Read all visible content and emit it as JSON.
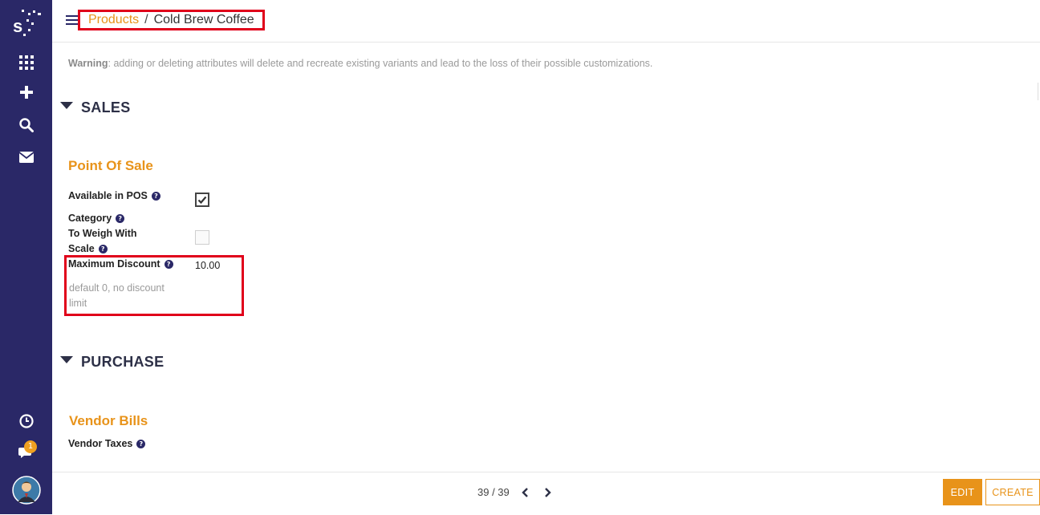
{
  "breadcrumb": {
    "parent": "Products",
    "separator": "/",
    "current": "Cold Brew Coffee"
  },
  "warning": {
    "label": "Warning",
    "text": ": adding or deleting attributes will delete and recreate existing variants and lead to the loss of their possible customizations."
  },
  "sections": {
    "sales": {
      "title": "SALES",
      "group": "Point Of Sale",
      "fields": {
        "available_in_pos": {
          "label": "Available in POS",
          "checked": true
        },
        "category": {
          "label": "Category",
          "value": ""
        },
        "to_weigh": {
          "label_line1": "To Weigh With",
          "label_line2": "Scale",
          "checked": false
        },
        "max_discount": {
          "label": "Maximum Discount",
          "value": "10.00",
          "hint": "default 0, no discount limit"
        }
      }
    },
    "purchase": {
      "title": "PURCHASE",
      "group": "Vendor Bills",
      "fields": {
        "vendor_taxes": {
          "label": "Vendor Taxes"
        }
      }
    }
  },
  "sidebar": {
    "icons": [
      "logo-icon",
      "apps-icon",
      "plus-icon",
      "search-icon",
      "mail-icon",
      "clock-icon",
      "chat-icon",
      "avatar"
    ],
    "chat_badge": "1"
  },
  "footer": {
    "pager": "39 / 39",
    "edit_label": "EDIT",
    "create_label": "CREATE"
  },
  "colors": {
    "sidebar": "#2a2867",
    "accent": "#e8931a",
    "highlight": "#e0001a"
  }
}
